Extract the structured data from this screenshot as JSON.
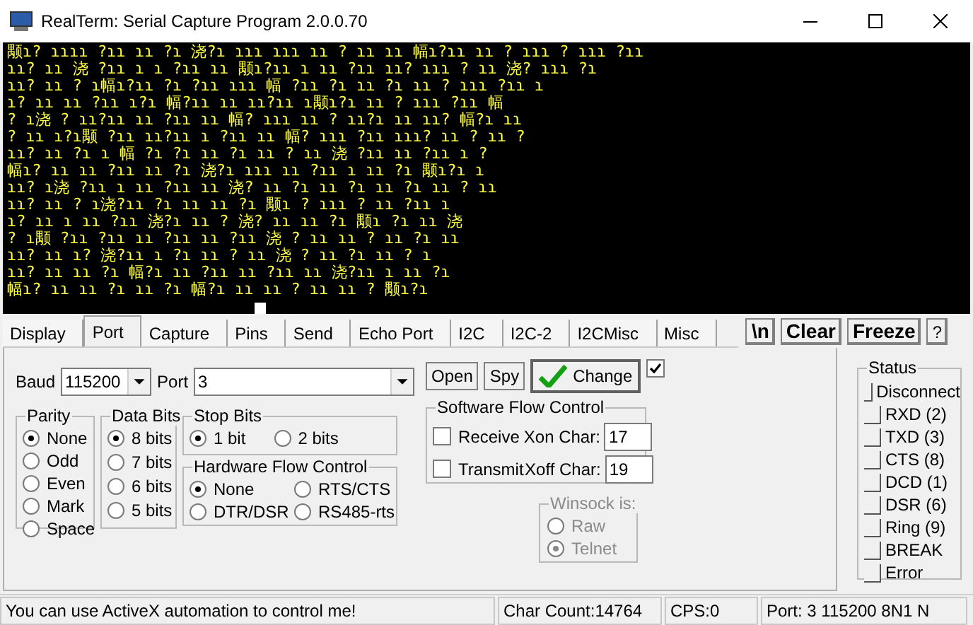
{
  "window": {
    "title": "RealTerm: Serial Capture Program 2.0.0.70"
  },
  "terminal": {
    "lines": [
      "颙ɿ? ɿɿɿɿ ?ɿɿ ɿɿ ?ɿ 浇?ɿ ɿɿɿ ɿɿɿ ɿɿ ? ɿɿ ɿɿ 幅ɿ?ɿɿ ɿɿ ? ɿɿɿ ? ɿɿɿ ?ɿɿ",
      "ɿɿ? ɿɿ 浇 ?ɿɿ ɿ ɿ ?ɿɿ ɿɿ 颙ɿ?ɿɿ ɿ ɿɿ ?ɿɿ ɿɿ? ɿɿɿ ? ɿɿ 浇? ɿɿɿ ?ɿ",
      "ɿɿ? ɿɿ ? ɿ幅ɿ?ɿɿ ?ɿ ?ɿɿ ɿɿɿ 幅 ?ɿɿ ?ɿ ɿɿ ?ɿ ɿɿ ? ɿɿɿ ?ɿɿ ɿ",
      "ɿ? ɿɿ ɿɿ ?ɿɿ ɿ?ɿ 幅?ɿɿ ɿɿ ɿɿ?ɿɿ ɿ颙ɿ?ɿ ɿɿ ? ɿɿɿ ?ɿɿ 幅",
      "? ɿ浇 ? ɿɿ?ɿɿ ɿɿ ?ɿɿ ɿɿ 幅? ɿɿɿ ɿɿ ? ɿɿ?ɿ ɿɿ ɿɿ? 幅?ɿ ɿɿ",
      "? ɿɿ ɿ?ɿ颙 ?ɿɿ ɿɿ?ɿɿ ɿ ?ɿɿ ɿɿ 幅? ɿɿɿ ?ɿɿ ɿɿɿ? ɿɿ ? ɿɿ ?",
      "ɿɿ? ɿɿ ?ɿ ɿ 幅 ?ɿ ?ɿ ɿɿ ?ɿ ɿɿ ? ɿɿ 浇 ?ɿɿ ɿɿ ?ɿɿ ɿ ?",
      "幅ɿ? ɿɿ ɿɿ ?ɿɿ ɿɿ ?ɿ 浇?ɿ ɿɿɿ ɿɿ ?ɿɿ ɿ ɿɿ ?ɿ 颙ɿ?ɿ ɿ",
      "ɿɿ? ɿ浇 ?ɿɿ ɿ ɿɿ ?ɿɿ ɿɿ 浇? ɿɿ ?ɿ ɿɿ ?ɿ ɿɿ ?ɿ ɿɿ ? ɿɿ",
      "ɿɿ? ɿɿ ? ɿ浇?ɿɿ ?ɿ ɿɿ ɿɿ ?ɿ 颙ɿ ? ɿɿɿ ? ɿɿ ?ɿɿ ɿ",
      "ɿ? ɿɿ ɿ ɿɿ ?ɿɿ 浇?ɿ ɿɿ ? 浇? ɿɿ ɿɿ ?ɿ 颙ɿ ?ɿ ɿɿ 浇",
      "? ɿ颙 ?ɿɿ ?ɿɿ ɿɿ ?ɿɿ ɿɿ ?ɿɿ 浇 ? ɿɿ ɿɿ ? ɿɿ ?ɿ ɿɿ",
      "ɿɿ? ɿɿ ɿ? 浇?ɿɿ ɿ ?ɿ ɿɿ ? ɿɿ 浇 ? ɿɿ ?ɿ ɿɿ ? ɿ",
      "ɿɿ? ɿɿ ɿɿ ?ɿ 幅?ɿ ɿɿ ?ɿɿ ɿɿ ?ɿɿ ɿɿ 浇?ɿɿ ɿ ɿɿ ?ɿ",
      "幅ɿ? ɿɿ ɿɿ ?ɿ ɿɿ ?ɿ 幅?ɿ ɿɿ ɿɿ ? ɿɿ ɿɿ ? 颙ɿ?ɿ"
    ]
  },
  "tabs": [
    {
      "label": "Display",
      "selected": false
    },
    {
      "label": "Port",
      "selected": true
    },
    {
      "label": "Capture",
      "selected": false
    },
    {
      "label": "Pins",
      "selected": false
    },
    {
      "label": "Send",
      "selected": false
    },
    {
      "label": "Echo Port",
      "selected": false
    },
    {
      "label": "I2C",
      "selected": false
    },
    {
      "label": "I2C-2",
      "selected": false
    },
    {
      "label": "I2CMisc",
      "selected": false
    },
    {
      "label": "Misc",
      "selected": false
    }
  ],
  "toolbar_buttons": [
    "\\n",
    "Clear",
    "Freeze",
    "?"
  ],
  "baud": {
    "label": "Baud",
    "value": "115200"
  },
  "port": {
    "label": "Port",
    "value": "3"
  },
  "open_button": "Open",
  "spy_button": "Spy",
  "change_button": "Change",
  "change_checkbox": {
    "checked": true
  },
  "parity": {
    "title": "Parity",
    "options": [
      {
        "label": "None",
        "selected": true
      },
      {
        "label": "Odd",
        "selected": false
      },
      {
        "label": "Even",
        "selected": false
      },
      {
        "label": "Mark",
        "selected": false
      },
      {
        "label": "Space",
        "selected": false
      }
    ]
  },
  "data_bits": {
    "title": "Data Bits",
    "options": [
      {
        "label": "8 bits",
        "selected": true
      },
      {
        "label": "7 bits",
        "selected": false
      },
      {
        "label": "6 bits",
        "selected": false
      },
      {
        "label": "5 bits",
        "selected": false
      }
    ]
  },
  "stop_bits": {
    "title": "Stop Bits",
    "options": [
      {
        "label": "1 bit",
        "selected": true
      },
      {
        "label": "2 bits",
        "selected": false
      }
    ]
  },
  "hardware_flow": {
    "title": "Hardware Flow Control",
    "options": [
      {
        "label": "None",
        "selected": true
      },
      {
        "label": "RTS/CTS",
        "selected": false
      },
      {
        "label": "DTR/DSR",
        "selected": false
      },
      {
        "label": "RS485-rts",
        "selected": false
      }
    ]
  },
  "software_flow": {
    "title": "Software Flow Control",
    "receive": {
      "label": "Receive",
      "checked": false
    },
    "transmit": {
      "label": "Transmit",
      "checked": false
    },
    "xon": {
      "label": "Xon Char:",
      "value": "17"
    },
    "xoff": {
      "label": "Xoff Char:",
      "value": "19"
    }
  },
  "winsock": {
    "title": "Winsock is:",
    "disabled": true,
    "options": [
      {
        "label": "Raw",
        "selected": false
      },
      {
        "label": "Telnet",
        "selected": true
      }
    ]
  },
  "status": {
    "title": "Status",
    "items": [
      {
        "label": "Disconnect",
        "on": false
      },
      {
        "label": "RXD (2)",
        "on": false
      },
      {
        "label": "TXD (3)",
        "on": false
      },
      {
        "label": "CTS (8)",
        "on": false
      },
      {
        "label": "DCD (1)",
        "on": false
      },
      {
        "label": "DSR (6)",
        "on": false
      },
      {
        "label": "Ring (9)",
        "on": false
      },
      {
        "label": "BREAK",
        "on": false
      },
      {
        "label": "Error",
        "on": false
      }
    ]
  },
  "status_bar": [
    "You can use ActiveX automation to control me!",
    "Char Count:14764",
    "CPS:0",
    "Port: 3 115200 8N1 N"
  ]
}
